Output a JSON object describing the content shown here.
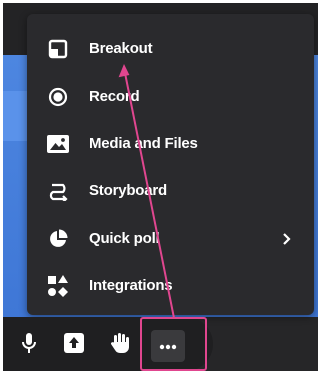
{
  "menu": {
    "items": [
      {
        "label": "Breakout",
        "icon": "breakout-icon"
      },
      {
        "label": "Record",
        "icon": "record-icon"
      },
      {
        "label": "Media and Files",
        "icon": "image-icon"
      },
      {
        "label": "Storyboard",
        "icon": "storyboard-icon"
      },
      {
        "label": "Quick poll",
        "icon": "pie-chart-icon",
        "has_submenu": true
      },
      {
        "label": "Integrations",
        "icon": "integrations-icon"
      }
    ]
  },
  "toolbar": {
    "buttons": [
      {
        "icon": "microphone-icon"
      },
      {
        "icon": "share-upload-icon"
      },
      {
        "icon": "raise-hand-icon"
      },
      {
        "icon": "more-options-icon",
        "highlighted": true
      }
    ]
  },
  "colors": {
    "menu_bg": "#2a2a2d",
    "toolbar_bg": "#1f1f21",
    "background_blue": "#4d86e0",
    "annotation": "#e0468f",
    "text": "#ffffff"
  }
}
